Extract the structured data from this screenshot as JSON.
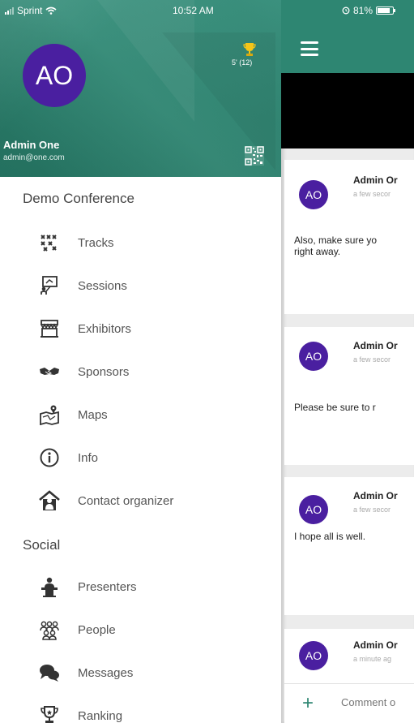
{
  "status_bar": {
    "carrier": "Sprint",
    "time": "10:52 AM",
    "battery": "81%"
  },
  "profile": {
    "initials": "AO",
    "name": "Admin One",
    "email": "admin@one.com",
    "score": "5' (12)",
    "trophy_icon": "trophy-icon",
    "qr_icon": "qr-code-icon"
  },
  "sections": {
    "conference": "Demo Conference",
    "social": "Social"
  },
  "menu": {
    "tracks": "Tracks",
    "sessions": "Sessions",
    "exhibitors": "Exhibitors",
    "sponsors": "Sponsors",
    "maps": "Maps",
    "info": "Info",
    "contact": "Contact organizer",
    "presenters": "Presenters",
    "people": "People",
    "messages": "Messages",
    "ranking": "Ranking"
  },
  "posts": [
    {
      "initials": "AO",
      "author": "Admin Or",
      "time": "a few secor",
      "line1": "Also, make sure yo",
      "line2": "right away."
    },
    {
      "initials": "AO",
      "author": "Admin Or",
      "time": "a few secor",
      "line1": "Please be sure to r",
      "line2": ""
    },
    {
      "initials": "AO",
      "author": "Admin Or",
      "time": "a few secor",
      "line1": "I hope all is well.",
      "line2": ""
    },
    {
      "initials": "AO",
      "author": "Admin Or",
      "time": "a minute ag",
      "line1": "",
      "line2": ""
    }
  ],
  "comment": {
    "placeholder": "Comment o",
    "add_icon": "+"
  },
  "colors": {
    "brand_green": "#2e8672",
    "avatar_purple": "#4a1fa0"
  }
}
